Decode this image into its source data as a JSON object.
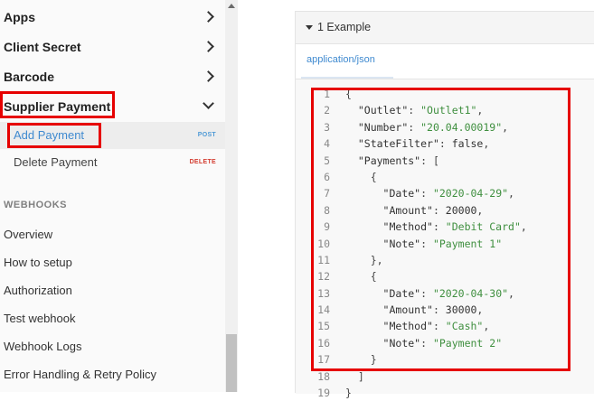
{
  "sidebar": {
    "groups": [
      {
        "label": "Apps",
        "expanded": false
      },
      {
        "label": "Client Secret",
        "expanded": false
      },
      {
        "label": "Barcode",
        "expanded": false
      },
      {
        "label": "Supplier Payment",
        "expanded": true
      }
    ],
    "sub_items": [
      {
        "label": "Add Payment",
        "method": "POST",
        "active": true
      },
      {
        "label": "Delete Payment",
        "method": "DELETE",
        "active": false
      }
    ],
    "section_heading": "WEBHOOKS",
    "webhook_items": [
      "Overview",
      "How to setup",
      "Authorization",
      "Test webhook",
      "Webhook Logs",
      "Error Handling & Retry Policy"
    ]
  },
  "example_panel": {
    "title": "1 Example",
    "tab": "application/json",
    "code_lines": [
      {
        "n": "1",
        "parts": [
          {
            "t": "p",
            "v": "{"
          }
        ]
      },
      {
        "n": "2",
        "parts": [
          {
            "t": "p",
            "v": "  "
          },
          {
            "t": "k",
            "v": "\"Outlet\""
          },
          {
            "t": "p",
            "v": ": "
          },
          {
            "t": "s",
            "v": "\"Outlet1\""
          },
          {
            "t": "p",
            "v": ","
          }
        ]
      },
      {
        "n": "3",
        "parts": [
          {
            "t": "p",
            "v": "  "
          },
          {
            "t": "k",
            "v": "\"Number\""
          },
          {
            "t": "p",
            "v": ": "
          },
          {
            "t": "s",
            "v": "\"20.04.00019\""
          },
          {
            "t": "p",
            "v": ","
          }
        ]
      },
      {
        "n": "4",
        "parts": [
          {
            "t": "p",
            "v": "  "
          },
          {
            "t": "k",
            "v": "\"StateFilter\""
          },
          {
            "t": "p",
            "v": ": "
          },
          {
            "t": "n",
            "v": "false"
          },
          {
            "t": "p",
            "v": ","
          }
        ]
      },
      {
        "n": "5",
        "parts": [
          {
            "t": "p",
            "v": "  "
          },
          {
            "t": "k",
            "v": "\"Payments\""
          },
          {
            "t": "p",
            "v": ": ["
          }
        ]
      },
      {
        "n": "6",
        "parts": [
          {
            "t": "p",
            "v": "    {"
          }
        ]
      },
      {
        "n": "7",
        "parts": [
          {
            "t": "p",
            "v": "      "
          },
          {
            "t": "k",
            "v": "\"Date\""
          },
          {
            "t": "p",
            "v": ": "
          },
          {
            "t": "s",
            "v": "\"2020-04-29\""
          },
          {
            "t": "p",
            "v": ","
          }
        ]
      },
      {
        "n": "8",
        "parts": [
          {
            "t": "p",
            "v": "      "
          },
          {
            "t": "k",
            "v": "\"Amount\""
          },
          {
            "t": "p",
            "v": ": "
          },
          {
            "t": "n",
            "v": "20000"
          },
          {
            "t": "p",
            "v": ","
          }
        ]
      },
      {
        "n": "9",
        "parts": [
          {
            "t": "p",
            "v": "      "
          },
          {
            "t": "k",
            "v": "\"Method\""
          },
          {
            "t": "p",
            "v": ": "
          },
          {
            "t": "s",
            "v": "\"Debit Card\""
          },
          {
            "t": "p",
            "v": ","
          }
        ]
      },
      {
        "n": "10",
        "parts": [
          {
            "t": "p",
            "v": "      "
          },
          {
            "t": "k",
            "v": "\"Note\""
          },
          {
            "t": "p",
            "v": ": "
          },
          {
            "t": "s",
            "v": "\"Payment 1\""
          }
        ]
      },
      {
        "n": "11",
        "parts": [
          {
            "t": "p",
            "v": "    },"
          }
        ]
      },
      {
        "n": "12",
        "parts": [
          {
            "t": "p",
            "v": "    {"
          }
        ]
      },
      {
        "n": "13",
        "parts": [
          {
            "t": "p",
            "v": "      "
          },
          {
            "t": "k",
            "v": "\"Date\""
          },
          {
            "t": "p",
            "v": ": "
          },
          {
            "t": "s",
            "v": "\"2020-04-30\""
          },
          {
            "t": "p",
            "v": ","
          }
        ]
      },
      {
        "n": "14",
        "parts": [
          {
            "t": "p",
            "v": "      "
          },
          {
            "t": "k",
            "v": "\"Amount\""
          },
          {
            "t": "p",
            "v": ": "
          },
          {
            "t": "n",
            "v": "30000"
          },
          {
            "t": "p",
            "v": ","
          }
        ]
      },
      {
        "n": "15",
        "parts": [
          {
            "t": "p",
            "v": "      "
          },
          {
            "t": "k",
            "v": "\"Method\""
          },
          {
            "t": "p",
            "v": ": "
          },
          {
            "t": "s",
            "v": "\"Cash\""
          },
          {
            "t": "p",
            "v": ","
          }
        ]
      },
      {
        "n": "16",
        "parts": [
          {
            "t": "p",
            "v": "      "
          },
          {
            "t": "k",
            "v": "\"Note\""
          },
          {
            "t": "p",
            "v": ": "
          },
          {
            "t": "s",
            "v": "\"Payment 2\""
          }
        ]
      },
      {
        "n": "17",
        "parts": [
          {
            "t": "p",
            "v": "    }"
          }
        ]
      },
      {
        "n": "18",
        "parts": [
          {
            "t": "p",
            "v": "  ]"
          }
        ]
      },
      {
        "n": "19",
        "parts": [
          {
            "t": "p",
            "v": "}"
          }
        ]
      }
    ]
  },
  "colors": {
    "highlight": "#e60000",
    "link_active": "#3f8ad0",
    "method_post": "#4f9ad6",
    "method_delete": "#d33b2f",
    "json_string": "#3f8f3f"
  }
}
